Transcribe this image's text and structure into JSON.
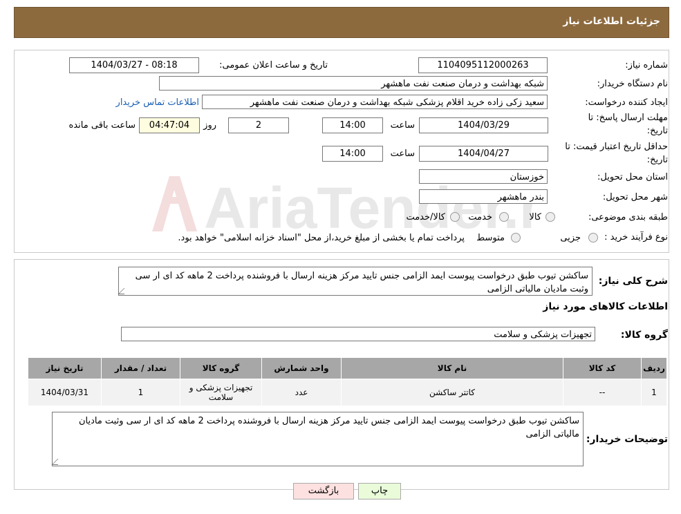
{
  "header": {
    "title": "جزئیات اطلاعات نیاز"
  },
  "form": {
    "need_number_label": "شماره نیاز:",
    "need_number": "1104095112000263",
    "announce_label": "تاریخ و ساعت اعلان عمومی:",
    "announce_value": "1404/03/27 - 08:18",
    "buyer_org_label": "نام دستگاه خریدار:",
    "buyer_org": "شبکه بهداشت و درمان صنعت نفت ماهشهر",
    "creator_label": "ایجاد کننده درخواست:",
    "creator": "سعید زکی زاده خرید اقلام پزشکی شبکه بهداشت و درمان صنعت نفت ماهشهر",
    "contact_link": "اطلاعات تماس خریدار",
    "deadline_label_1": "مهلت ارسال پاسخ: تا",
    "deadline_label_2": "تاریخ:",
    "deadline_date": "1404/03/29",
    "time_label": "ساعت",
    "deadline_time": "14:00",
    "days_value": "2",
    "days_label": "روز و",
    "remaining_time": "04:47:04",
    "remaining_label": "ساعت باقی مانده",
    "validity_label_1": "حداقل تاریخ اعتبار قیمت: تا",
    "validity_label_2": "تاریخ:",
    "validity_date": "1404/04/27",
    "validity_time": "14:00",
    "province_label": "استان محل تحویل:",
    "province": "خوزستان",
    "city_label": "شهر محل تحویل:",
    "city": "بندر ماهشهر",
    "category_label": "طبقه بندی موضوعی:",
    "category_options": [
      "کالا",
      "خدمت",
      "کالا/خدمت"
    ],
    "process_label": "نوع فرآیند خرید :",
    "process_options": [
      "جزیی",
      "متوسط"
    ],
    "process_note": "پرداخت تمام یا بخشی از مبلغ خرید،از محل \"اسناد خزانه اسلامی\" خواهد بود."
  },
  "summary": {
    "description_label": "شرح کلی نیاز:",
    "description": "ساکشن تیوب طبق درخواست پیوست ایمد الزامی جنس تایید مرکز هزینه ارسال با فروشنده پرداخت 2 ماهه کد ای ار سی وثبت مادیان مالیاتی الزامی",
    "goods_info_title": "اطلاعات کالاهای مورد نیاز",
    "goods_group_label": "گروه کالا:",
    "goods_group": "تجهیزات پزشکی و سلامت"
  },
  "table": {
    "headers": [
      "ردیف",
      "کد کالا",
      "نام کالا",
      "واحد شمارش",
      "گروه کالا",
      "تعداد / مقدار",
      "تاریخ نیاز"
    ],
    "rows": [
      [
        "1",
        "--",
        "کاتتر ساکشن",
        "عدد",
        "تجهیزات پزشکی و سلامت",
        "1",
        "1404/03/31"
      ]
    ]
  },
  "buyer_notes": {
    "label": "توضیحات خریدار:",
    "text": "ساکشن تیوب طبق درخواست پیوست ایمد الزامی جنس تایید مرکز هزینه ارسال با فروشنده پرداخت 2 ماهه کد ای ار سی وثبت مادیان مالیاتی الزامی"
  },
  "buttons": {
    "print": "چاپ",
    "back": "بازگشت"
  },
  "watermark": {
    "text": "AriaTender.neT"
  },
  "colors": {
    "header_bg": "#8d6a3e",
    "link": "#1a5fb4",
    "print_bg": "#e9fbd9",
    "back_bg": "#fde0e0"
  }
}
